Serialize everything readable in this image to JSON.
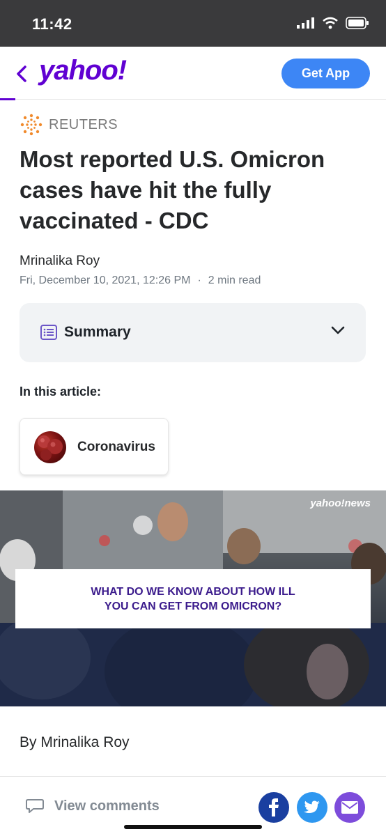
{
  "status_bar": {
    "time": "11:42"
  },
  "header": {
    "logo": "yahoo!",
    "get_app_label": "Get App"
  },
  "article": {
    "source": "REUTERS",
    "headline": "Most reported U.S. Omicron cases have hit the fully vaccinated - CDC",
    "author": "Mrinalika Roy",
    "date": "Fri, December 10, 2021, 12:26 PM",
    "read_time": "2 min read",
    "summary_label": "Summary",
    "in_this_article": "In this article:",
    "topic": "Coronavirus",
    "video": {
      "brand": "yahoo!news",
      "caption_line1": "WHAT DO WE KNOW ABOUT HOW ILL",
      "caption_line2": "YOU CAN GET FROM OMICRON?"
    },
    "byline": "By Mrinalika Roy"
  },
  "bottom_bar": {
    "view_comments": "View comments"
  },
  "colors": {
    "brand_purple": "#6001d2",
    "get_app_blue": "#3d86f5",
    "facebook": "#1a3fa0",
    "twitter": "#2e97f0",
    "mail": "#7d4cdb"
  },
  "icons": [
    "back-chevron-icon",
    "signal-icon",
    "wifi-icon",
    "battery-icon",
    "reuters-logo-icon",
    "summary-list-icon",
    "chevron-down-icon",
    "comment-bubble-icon",
    "facebook-icon",
    "twitter-icon",
    "mail-icon"
  ]
}
